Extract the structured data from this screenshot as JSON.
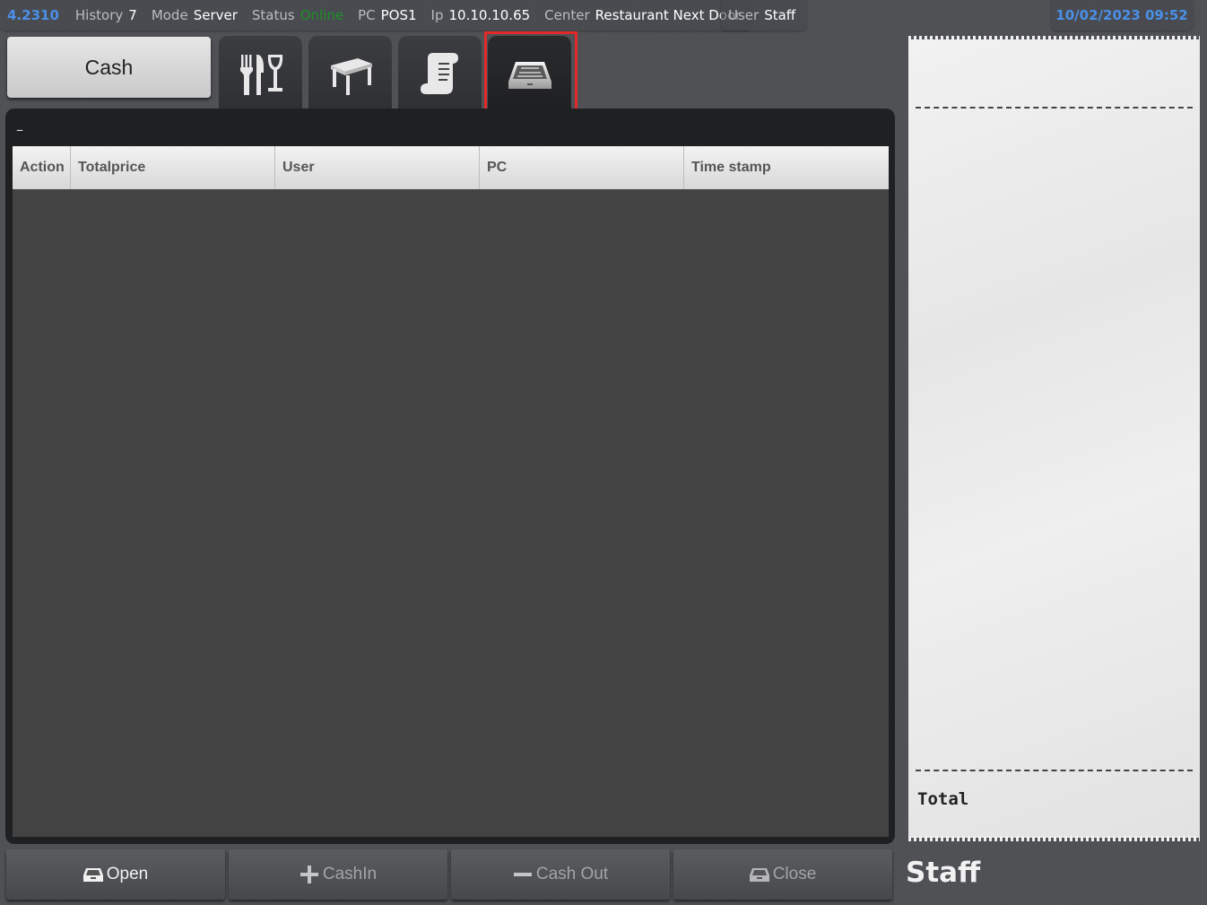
{
  "status_bar": {
    "version": "4.2310",
    "history_label": "History",
    "history_value": "7",
    "mode_label": "Mode",
    "mode_value": "Server",
    "status_label": "Status",
    "status_value": "Online",
    "pc_label": "PC",
    "pc_value": "POS1",
    "ip_label": "Ip",
    "ip_value": "10.10.10.65",
    "center_label": "Center",
    "center_value": "Restaurant Next Door",
    "user_label": "User",
    "user_value": "Staff",
    "datetime": "10/02/2023 09:52"
  },
  "cash_button": {
    "label": "Cash"
  },
  "tabs": [
    {
      "icon": "cutlery-glass-icon",
      "active": false
    },
    {
      "icon": "table-icon",
      "active": false
    },
    {
      "icon": "receipt-icon",
      "active": false
    },
    {
      "icon": "cash-drawer-icon",
      "active": true
    }
  ],
  "panel": {
    "title": "–",
    "columns": [
      "Action",
      "Totalprice",
      "User",
      "PC",
      "Time stamp"
    ],
    "rows": []
  },
  "receipt": {
    "total_label": "Total"
  },
  "staff_name": "Staff",
  "bottom_buttons": [
    {
      "label": "Open",
      "icon": "cash-drawer-icon",
      "enabled": true
    },
    {
      "label": "CashIn",
      "icon": "plus-icon",
      "enabled": false
    },
    {
      "label": "Cash Out",
      "icon": "minus-icon",
      "enabled": false
    },
    {
      "label": "Close",
      "icon": "cash-drawer-icon",
      "enabled": false
    }
  ],
  "colors": {
    "status_online": "#1e8f2a",
    "accent_blue": "#4a90e8",
    "highlight_red": "#e32a2a"
  }
}
